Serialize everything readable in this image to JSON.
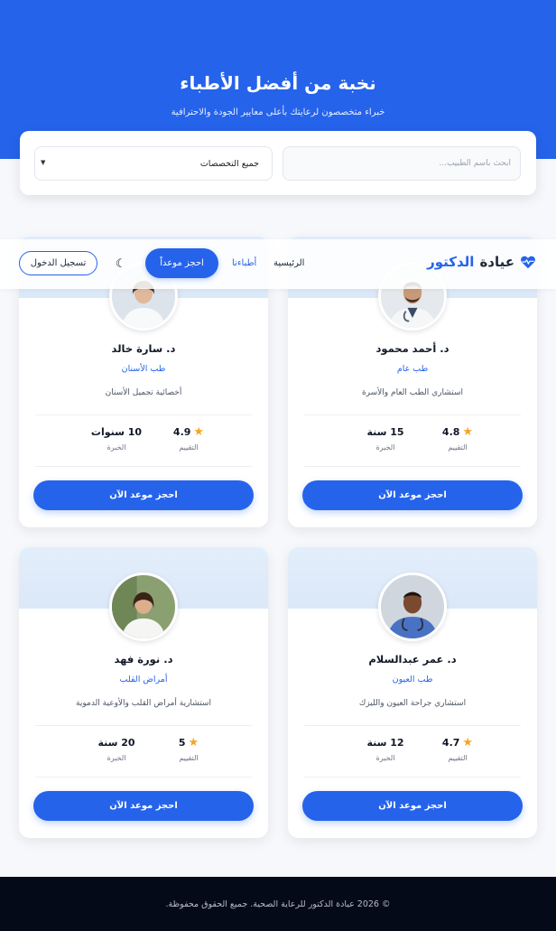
{
  "hero": {
    "title": "نخبة من أفضل الأطباء",
    "subtitle": "خبراء متخصصون لرعايتك بأعلى معايير الجودة والاحترافية"
  },
  "search": {
    "placeholder": "ابحث باسم الطبيب...",
    "specialty_selected": "جميع التخصصات"
  },
  "navbar": {
    "brand_part1": "عيادة",
    "brand_part2": "الدكتور",
    "home": "الرئيسية",
    "doctors": "أطباءنا",
    "book": "احجز موعداً",
    "login": "تسجيل الدخول"
  },
  "labels": {
    "rating": "التقييم",
    "experience": "الخبرة",
    "book_now": "احجز موعد الآن"
  },
  "doctors": [
    {
      "name": "د. أحمد محمود",
      "specialty": "طب عام",
      "description": "استشاري الطب العام والأسرة",
      "rating": "4.8",
      "experience": "15 سنة"
    },
    {
      "name": "د. سارة خالد",
      "specialty": "طب الأسنان",
      "description": "أخصائية تجميل الأسنان",
      "rating": "4.9",
      "experience": "10 سنوات"
    },
    {
      "name": "د. عمر عبدالسلام",
      "specialty": "طب العيون",
      "description": "استشاري جراحة العيون والليزك",
      "rating": "4.7",
      "experience": "12 سنة"
    },
    {
      "name": "د. نورة فهد",
      "specialty": "أمراض القلب",
      "description": "استشارية أمراض القلب والأوعية الدموية",
      "rating": "5",
      "experience": "20 سنة"
    }
  ],
  "footer": {
    "text": "© 2026 عيادة الدكتور للرعاية الصحية. جميع الحقوق محفوظة."
  },
  "colors": {
    "primary": "#2563eb",
    "footer_bg": "#050a18",
    "star": "#f5a524"
  }
}
